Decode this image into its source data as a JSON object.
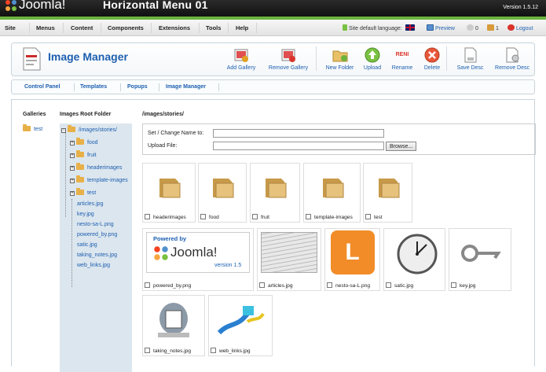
{
  "header": {
    "logo_text": "Joomla!",
    "site_name": "Horizontal Menu 01",
    "version": "Version 1.5.12"
  },
  "menu": {
    "items": [
      "Site",
      "Menus",
      "Content",
      "Components",
      "Extensions",
      "Tools",
      "Help"
    ],
    "site_language_label": "Site default language:",
    "preview": "Preview",
    "messages_count": "0",
    "users_count": "1",
    "logout": "Logout"
  },
  "toolbar": {
    "title": "Image Manager",
    "buttons": {
      "add_gallery": "Add Gallery",
      "remove_gallery": "Remove Gallery",
      "new_folder": "New Folder",
      "upload": "Upload",
      "rename": "Rename",
      "rename_icon_text": "RENI",
      "delete": "Delete",
      "save_desc": "Save Desc",
      "remove_desc": "Remove Desc"
    }
  },
  "subnav": {
    "items": [
      "Control Panel",
      "Templates",
      "Popups",
      "Image Manager"
    ]
  },
  "galleries": {
    "heading": "Galleries",
    "items": [
      "test"
    ]
  },
  "tree": {
    "heading": "Images Root Folder",
    "root": "/images/stories/",
    "folders": [
      "food",
      "fruit",
      "headerimages",
      "template-images",
      "test"
    ],
    "files": [
      "articles.jpg",
      "key.jpg",
      "nesto-sa-L.png",
      "powered_by.png",
      "satic.jpg",
      "taking_notes.jpg",
      "web_links.jpg"
    ]
  },
  "content": {
    "path": "/images/stories/",
    "form": {
      "rename_label": "Set / Change Name to:",
      "upload_label": "Upload File:",
      "browse_button": "Browse..."
    },
    "folders": [
      "headerimages",
      "food",
      "fruit",
      "template-images",
      "test"
    ],
    "images": [
      "powered_by.png",
      "articles.jpg",
      "nesto-sa-L.png",
      "satic.jpg",
      "key.jpg",
      "taking_notes.jpg",
      "web_links.jpg"
    ],
    "powered_thumb": {
      "top": "Powered by",
      "brand": "Joomla!",
      "version": "version 1.5"
    },
    "l_thumb_letter": "L"
  },
  "colors": {
    "accent": "#1d5fb0",
    "green_bar": "#6cb33e",
    "tree_bg": "#dce6ee",
    "folder": "#e8b048"
  }
}
